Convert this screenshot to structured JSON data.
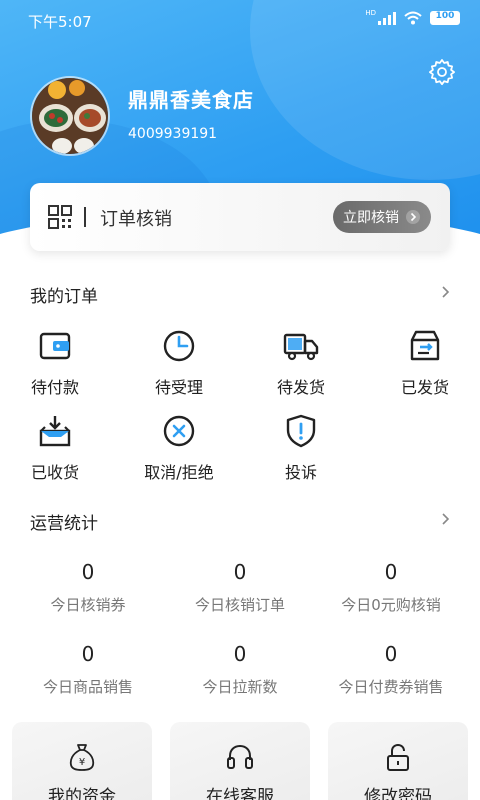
{
  "status_bar": {
    "time": "下午5:07",
    "battery": "100",
    "network": "HD"
  },
  "profile": {
    "shop_name": "鼎鼎香美食店",
    "phone": "4009939191"
  },
  "verify": {
    "label": "订单核销",
    "button": "立即核销"
  },
  "orders": {
    "title": "我的订单",
    "items": [
      {
        "label": "待付款",
        "icon": "wallet-icon"
      },
      {
        "label": "待受理",
        "icon": "clock-icon"
      },
      {
        "label": "待发货",
        "icon": "truck-icon"
      },
      {
        "label": "已发货",
        "icon": "box-shipped-icon"
      },
      {
        "label": "已收货",
        "icon": "tray-download-icon"
      },
      {
        "label": "取消/拒绝",
        "icon": "cancel-circle-icon"
      },
      {
        "label": "投诉",
        "icon": "shield-alert-icon"
      }
    ]
  },
  "stats": {
    "title": "运营统计",
    "items": [
      {
        "value": "0",
        "label": "今日核销券"
      },
      {
        "value": "0",
        "label": "今日核销订单"
      },
      {
        "value": "0",
        "label": "今日0元购核销"
      },
      {
        "value": "0",
        "label": "今日商品销售"
      },
      {
        "value": "0",
        "label": "今日拉新数"
      },
      {
        "value": "0",
        "label": "今日付费券销售"
      }
    ]
  },
  "tools": [
    {
      "label": "我的资金",
      "icon": "money-bag-icon"
    },
    {
      "label": "在线客服",
      "icon": "headset-icon"
    },
    {
      "label": "修改密码",
      "icon": "lock-icon"
    }
  ],
  "colors": {
    "brand_blue": "#2f9ff2",
    "verify_button": "#777777"
  }
}
